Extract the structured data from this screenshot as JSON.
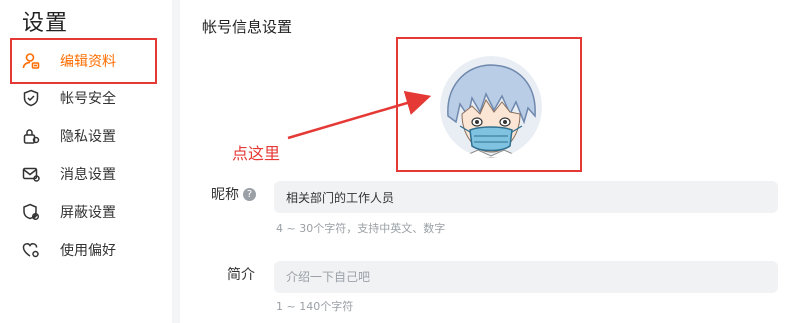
{
  "sidebar": {
    "title": "设置",
    "items": [
      {
        "label": "编辑资料",
        "icon": "user-edit-icon",
        "active": true
      },
      {
        "label": "帐号安全",
        "icon": "shield-icon"
      },
      {
        "label": "隐私设置",
        "icon": "lock-icon"
      },
      {
        "label": "消息设置",
        "icon": "mail-icon"
      },
      {
        "label": "屏蔽设置",
        "icon": "block-icon"
      },
      {
        "label": "使用偏好",
        "icon": "heart-settings-icon"
      }
    ]
  },
  "main": {
    "title": "帐号信息设置",
    "annotation": "点这里",
    "nickname": {
      "label": "昵称",
      "help": "?",
      "value": "相关部门的工作人员",
      "tip": "4 ~ 30个字符，支持中英文、数字"
    },
    "bio": {
      "label": "简介",
      "placeholder": "介绍一下自己吧",
      "tip": "1 ~ 140个字符"
    }
  },
  "colors": {
    "accent": "#ff6d00",
    "highlight": "#e53935",
    "field_bg": "#f1f2f4"
  }
}
